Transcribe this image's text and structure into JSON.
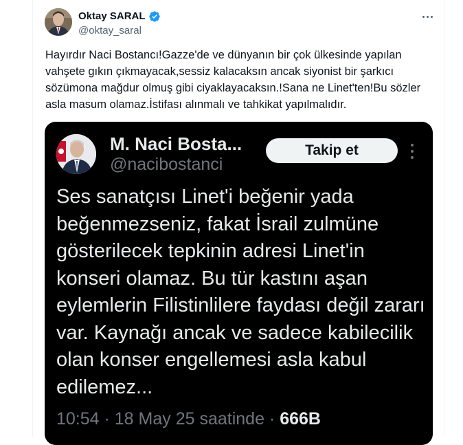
{
  "post": {
    "author_name": "Oktay SARAL",
    "author_handle": "@oktay_saral",
    "text": "Hayırdır Naci Bostancı!Gazze'de ve dünyanın bir çok ülkesinde yapılan vahşete gıkın çıkmayacak,sessiz kalacaksın ancak siyonist bir şarkıcı sözümona mağdur olmuş gibi ciyaklayacaksın.!Sana ne Linet'ten!Bu sözler asla masum olamaz.İstifası alınmalı ve tahkikat yapılmalıdır.",
    "icons": {
      "verified": "verified-badge-icon",
      "more": "more-horizontal-icon"
    },
    "colors": {
      "verified": "#1d9bf0",
      "handle": "#536471"
    }
  },
  "embedded": {
    "author_name": "M. Naci Bosta...",
    "author_handle": "@nacibostanci",
    "follow_label": "Takip et",
    "text": "Ses sanatçısı Linet'i beğenir yada beğenmezseniz, fakat İsrail zulmüne gösterilecek tepkinin adresi Linet'in konseri olamaz. Bu tür kastını aşan eylemlerin Filistinlilere faydası değil zararı var. Kaynağı ancak ve sadece kabilecilik olan konser engellemesi asla kabul edilemez...",
    "meta_time": "10:54 · 18 May 25 saatinde · ",
    "meta_views": "666B",
    "icons": {
      "more": "more-vertical-icon"
    },
    "colors": {
      "background": "#000000",
      "text": "#e7e9ea",
      "muted": "#71767b"
    }
  }
}
